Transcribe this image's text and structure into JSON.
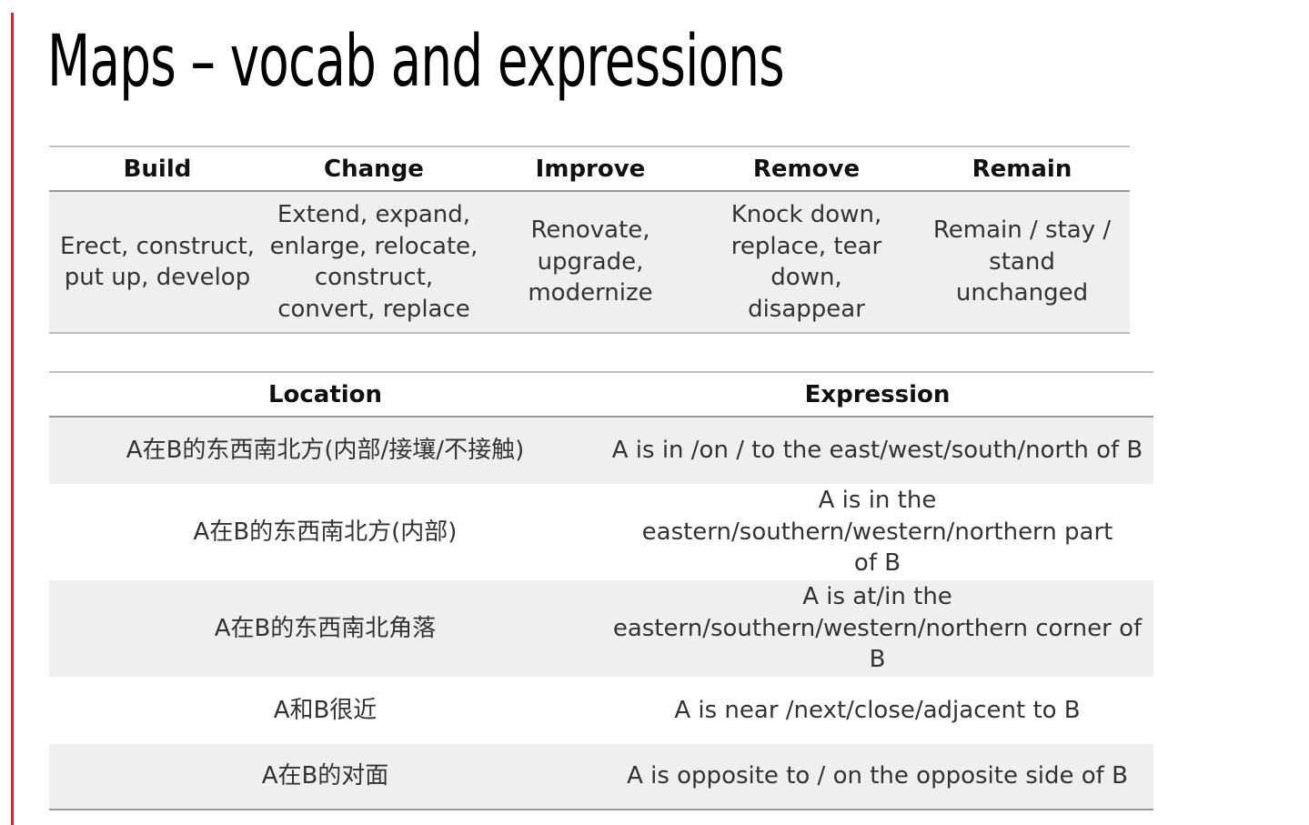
{
  "title": "Maps – vocab and expressions",
  "vocab_table": {
    "headers": [
      "Build",
      "Change",
      "Improve",
      "Remove",
      "Remain"
    ],
    "cells": [
      "Erect, construct, put up, develop",
      "Extend, expand, enlarge, relocate, construct, convert, replace",
      "Renovate, upgrade, modernize",
      "Knock down, replace, tear down, disappear",
      "Remain / stay / stand unchanged"
    ]
  },
  "location_table": {
    "headers": [
      "Location",
      "Expression"
    ],
    "rows": [
      {
        "location": "A在B的东西南北方(内部/接壤/不接触)",
        "expression": "A is in /on / to the east/west/south/north of B"
      },
      {
        "location": "A在B的东西南北方(内部)",
        "expression": "A is in the eastern/southern/western/northern part of B"
      },
      {
        "location": "A在B的东西南北角落",
        "expression": "A is at/in the eastern/southern/western/northern corner of B"
      },
      {
        "location": "A和B很近",
        "expression": "A is near /next/close/adjacent to B"
      },
      {
        "location": "A在B的对面",
        "expression": "A is opposite to / on the opposite side of B"
      }
    ]
  },
  "colors": {
    "accent_rule": "#d3242b",
    "row_shade": "#efefef"
  }
}
